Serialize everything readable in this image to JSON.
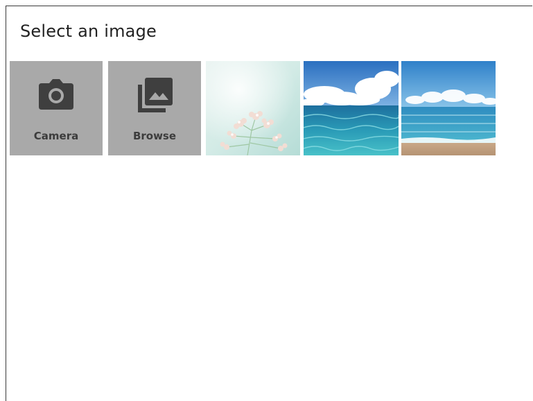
{
  "dialog": {
    "title": "Select an image"
  },
  "actions": [
    {
      "label": "Camera",
      "icon": "camera-icon"
    },
    {
      "label": "Browse",
      "icon": "photo-library-icon"
    }
  ],
  "images": [
    {
      "subject": "white-flowers"
    },
    {
      "subject": "ocean-waves"
    },
    {
      "subject": "sea-beach"
    }
  ],
  "colors": {
    "tile_background": "#a9a9a9",
    "icon": "#3f3f3f",
    "label": "#3c3c3c",
    "title": "#222222"
  }
}
